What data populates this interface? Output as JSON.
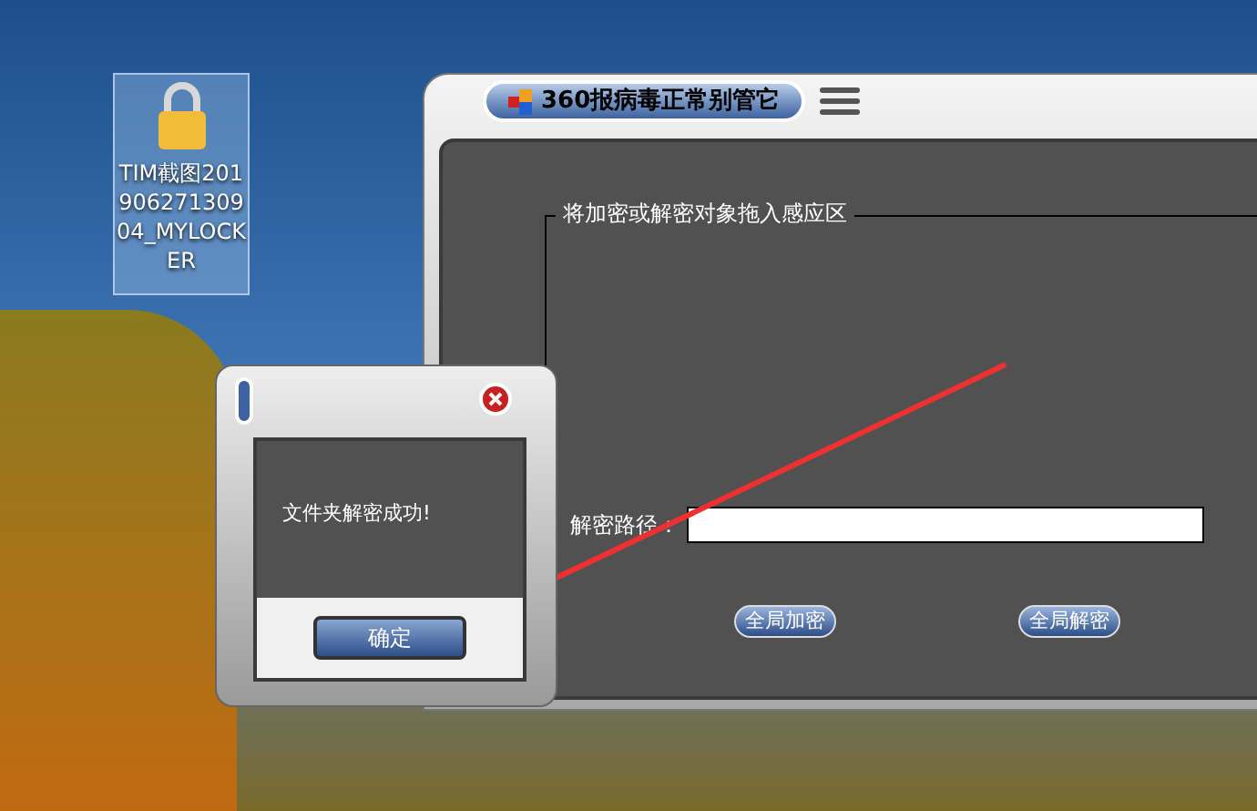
{
  "desktop_icon": {
    "label": "TIM截图20190627130904_MYLOCKER",
    "selected": true
  },
  "main_window": {
    "title": "360报病毒正常别管它",
    "group_label": "将加密或解密对象拖入感应区",
    "path_label": "解密路径：",
    "buttons": [
      "全局加密",
      "全局解密"
    ]
  },
  "dialog": {
    "message": "文件夹解密成功!",
    "ok_button": "确定"
  }
}
